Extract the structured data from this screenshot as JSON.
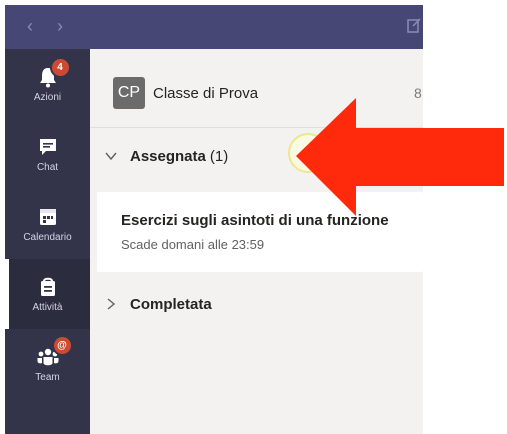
{
  "rail": {
    "items": [
      {
        "label": "Azioni",
        "icon": "bell-icon",
        "badge": "4"
      },
      {
        "label": "Chat",
        "icon": "chat-icon"
      },
      {
        "label": "Calendario",
        "icon": "calendar-icon"
      },
      {
        "label": "Attività",
        "icon": "assignments-icon",
        "active": true
      },
      {
        "label": "Team",
        "icon": "teams-icon",
        "badge": "@"
      }
    ]
  },
  "team": {
    "initials": "CP",
    "name": "Classe di Prova",
    "more": "8"
  },
  "sections": {
    "assigned": {
      "title": "Assegnata",
      "count": "(1)"
    },
    "completed": {
      "title": "Completata"
    }
  },
  "assignment": {
    "title": "Esercizi sugli asintoti di una funzione",
    "due": "Scade domani alle 23:59"
  },
  "colors": {
    "topbar": "#464775",
    "rail": "#33344a",
    "content_bg": "#f3f2f1",
    "arrow": "#ff2a0c",
    "badge": "#cc4a31"
  }
}
